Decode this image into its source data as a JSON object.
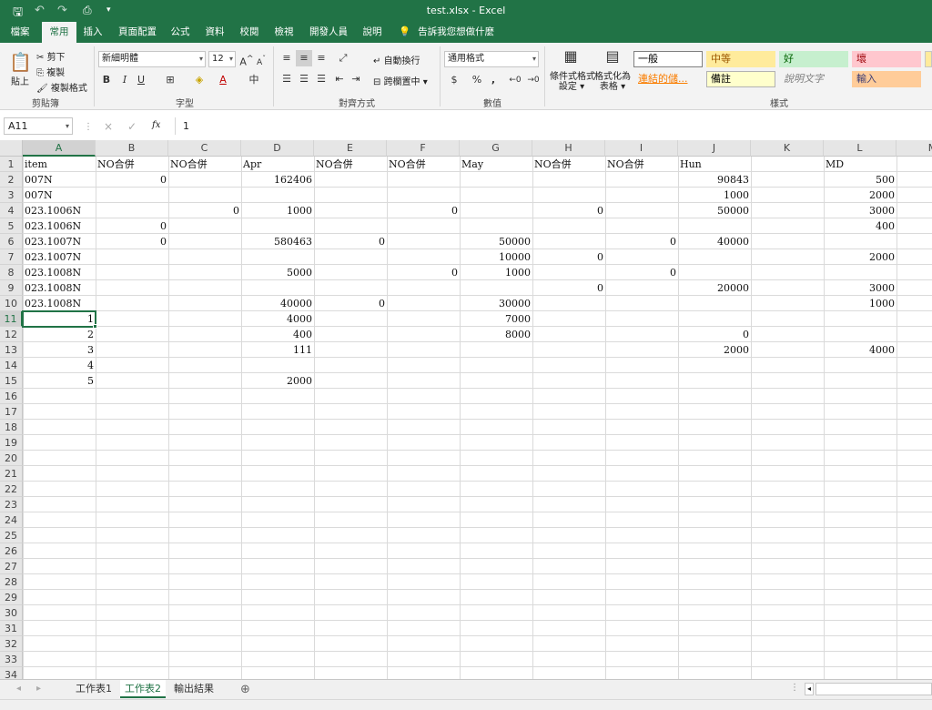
{
  "window": {
    "title": "test.xlsx  -  Excel",
    "quick_access": {
      "save_icon": "save-icon",
      "undo_icon": "undo-icon",
      "redo_icon": "redo-icon",
      "touch_icon": "touch-mode-icon",
      "customize": "▾"
    }
  },
  "ribbon_tabs": [
    "檔案",
    "常用",
    "插入",
    "頁面配置",
    "公式",
    "資料",
    "校閱",
    "檢視",
    "開發人員",
    "說明"
  ],
  "active_tab": "常用",
  "tell_me": "告訴我您想做什麼",
  "ribbon": {
    "clipboard": {
      "paste": "貼上",
      "cut": "剪下",
      "copy": "複製",
      "format_painter": "複製格式",
      "label": "剪貼簿"
    },
    "font": {
      "name": "新細明體",
      "size": "12",
      "bold": "B",
      "italic": "I",
      "underline": "U",
      "grow": "A",
      "shrink": "A",
      "label": "字型"
    },
    "alignment": {
      "wrap_text": "自動換行",
      "merge_center": "跨欄置中",
      "label": "對齊方式"
    },
    "number": {
      "format": "通用格式",
      "currency": "$",
      "percent": "%",
      "comma": ",",
      "label": "數值"
    },
    "styles": {
      "conditional": [
        "條件式格式",
        "設定"
      ],
      "format_as_table": [
        "格式化為",
        "表格"
      ],
      "cells": [
        {
          "text": "一般",
          "bg": "#ffffff",
          "fg": "#000000",
          "border": "#7f7f7f"
        },
        {
          "text": "中等",
          "bg": "#ffeb9c",
          "fg": "#9c5700"
        },
        {
          "text": "好",
          "bg": "#c6efce",
          "fg": "#006100"
        },
        {
          "text": "壞",
          "bg": "#ffc7ce",
          "fg": "#9c0006"
        },
        {
          "text": "連結的儲...",
          "bg": "#f3f3f3",
          "fg": "#fa7d00"
        },
        {
          "text": "備註",
          "bg": "#ffffcc",
          "fg": "#000000",
          "border": "#b2b2b2"
        },
        {
          "text": "說明文字",
          "bg": "#f3f3f3",
          "fg": "#7f7f7f"
        },
        {
          "text": "輸入",
          "bg": "#ffcc99",
          "fg": "#3f3f76"
        }
      ],
      "label": "樣式"
    }
  },
  "formula_bar": {
    "name_box": "A11",
    "cancel": "×",
    "enter": "✓",
    "fx": "fx",
    "value": "1"
  },
  "grid": {
    "columns": [
      "A",
      "B",
      "C",
      "D",
      "E",
      "F",
      "G",
      "H",
      "I",
      "J",
      "K",
      "L",
      "M"
    ],
    "selected_column": "A",
    "selected_row": 11,
    "row_count": 35,
    "cells": [
      {
        "r": 1,
        "c": 0,
        "v": "item",
        "a": "l"
      },
      {
        "r": 1,
        "c": 1,
        "v": "NO合併",
        "a": "l"
      },
      {
        "r": 1,
        "c": 2,
        "v": "NO合併",
        "a": "l"
      },
      {
        "r": 1,
        "c": 3,
        "v": "Apr",
        "a": "l"
      },
      {
        "r": 1,
        "c": 4,
        "v": "NO合併",
        "a": "l"
      },
      {
        "r": 1,
        "c": 5,
        "v": "NO合併",
        "a": "l"
      },
      {
        "r": 1,
        "c": 6,
        "v": "May",
        "a": "l"
      },
      {
        "r": 1,
        "c": 7,
        "v": "NO合併",
        "a": "l"
      },
      {
        "r": 1,
        "c": 8,
        "v": "NO合併",
        "a": "l"
      },
      {
        "r": 1,
        "c": 9,
        "v": "Hun",
        "a": "l"
      },
      {
        "r": 1,
        "c": 11,
        "v": "MD",
        "a": "l"
      },
      {
        "r": 2,
        "c": 0,
        "v": "007N",
        "a": "l"
      },
      {
        "r": 2,
        "c": 1,
        "v": "0",
        "a": "r"
      },
      {
        "r": 2,
        "c": 3,
        "v": "162406",
        "a": "r"
      },
      {
        "r": 2,
        "c": 9,
        "v": "90843",
        "a": "r"
      },
      {
        "r": 2,
        "c": 11,
        "v": "500",
        "a": "r"
      },
      {
        "r": 3,
        "c": 0,
        "v": "007N",
        "a": "l"
      },
      {
        "r": 3,
        "c": 9,
        "v": "1000",
        "a": "r"
      },
      {
        "r": 3,
        "c": 11,
        "v": "2000",
        "a": "r"
      },
      {
        "r": 4,
        "c": 0,
        "v": "023.1006N",
        "a": "l"
      },
      {
        "r": 4,
        "c": 2,
        "v": "0",
        "a": "r"
      },
      {
        "r": 4,
        "c": 3,
        "v": "1000",
        "a": "r"
      },
      {
        "r": 4,
        "c": 5,
        "v": "0",
        "a": "r"
      },
      {
        "r": 4,
        "c": 7,
        "v": "0",
        "a": "r"
      },
      {
        "r": 4,
        "c": 9,
        "v": "50000",
        "a": "r"
      },
      {
        "r": 4,
        "c": 11,
        "v": "3000",
        "a": "r"
      },
      {
        "r": 5,
        "c": 0,
        "v": "023.1006N",
        "a": "l"
      },
      {
        "r": 5,
        "c": 1,
        "v": "0",
        "a": "r"
      },
      {
        "r": 5,
        "c": 11,
        "v": "400",
        "a": "r"
      },
      {
        "r": 6,
        "c": 0,
        "v": "023.1007N",
        "a": "l"
      },
      {
        "r": 6,
        "c": 1,
        "v": "0",
        "a": "r"
      },
      {
        "r": 6,
        "c": 3,
        "v": "580463",
        "a": "r"
      },
      {
        "r": 6,
        "c": 4,
        "v": "0",
        "a": "r"
      },
      {
        "r": 6,
        "c": 6,
        "v": "50000",
        "a": "r"
      },
      {
        "r": 6,
        "c": 8,
        "v": "0",
        "a": "r"
      },
      {
        "r": 6,
        "c": 9,
        "v": "40000",
        "a": "r"
      },
      {
        "r": 7,
        "c": 0,
        "v": "023.1007N",
        "a": "l"
      },
      {
        "r": 7,
        "c": 6,
        "v": "10000",
        "a": "r"
      },
      {
        "r": 7,
        "c": 7,
        "v": "0",
        "a": "r"
      },
      {
        "r": 7,
        "c": 11,
        "v": "2000",
        "a": "r"
      },
      {
        "r": 8,
        "c": 0,
        "v": "023.1008N",
        "a": "l"
      },
      {
        "r": 8,
        "c": 3,
        "v": "5000",
        "a": "r"
      },
      {
        "r": 8,
        "c": 5,
        "v": "0",
        "a": "r"
      },
      {
        "r": 8,
        "c": 6,
        "v": "1000",
        "a": "r"
      },
      {
        "r": 8,
        "c": 8,
        "v": "0",
        "a": "r"
      },
      {
        "r": 9,
        "c": 0,
        "v": "023.1008N",
        "a": "l"
      },
      {
        "r": 9,
        "c": 7,
        "v": "0",
        "a": "r"
      },
      {
        "r": 9,
        "c": 9,
        "v": "20000",
        "a": "r"
      },
      {
        "r": 9,
        "c": 11,
        "v": "3000",
        "a": "r"
      },
      {
        "r": 10,
        "c": 0,
        "v": "023.1008N",
        "a": "l"
      },
      {
        "r": 10,
        "c": 3,
        "v": "40000",
        "a": "r"
      },
      {
        "r": 10,
        "c": 4,
        "v": "0",
        "a": "r"
      },
      {
        "r": 10,
        "c": 6,
        "v": "30000",
        "a": "r"
      },
      {
        "r": 10,
        "c": 11,
        "v": "1000",
        "a": "r"
      },
      {
        "r": 11,
        "c": 0,
        "v": "1",
        "a": "r"
      },
      {
        "r": 11,
        "c": 3,
        "v": "4000",
        "a": "r"
      },
      {
        "r": 11,
        "c": 6,
        "v": "7000",
        "a": "r"
      },
      {
        "r": 12,
        "c": 0,
        "v": "2",
        "a": "r"
      },
      {
        "r": 12,
        "c": 3,
        "v": "400",
        "a": "r"
      },
      {
        "r": 12,
        "c": 6,
        "v": "8000",
        "a": "r"
      },
      {
        "r": 12,
        "c": 9,
        "v": "0",
        "a": "r"
      },
      {
        "r": 13,
        "c": 0,
        "v": "3",
        "a": "r"
      },
      {
        "r": 13,
        "c": 3,
        "v": "111",
        "a": "r"
      },
      {
        "r": 13,
        "c": 9,
        "v": "2000",
        "a": "r"
      },
      {
        "r": 13,
        "c": 11,
        "v": "4000",
        "a": "r"
      },
      {
        "r": 14,
        "c": 0,
        "v": "4",
        "a": "r"
      },
      {
        "r": 15,
        "c": 0,
        "v": "5",
        "a": "r"
      },
      {
        "r": 15,
        "c": 3,
        "v": "2000",
        "a": "r"
      }
    ]
  },
  "sheets": [
    "工作表1",
    "工作表2",
    "輸出結果"
  ],
  "active_sheet": "工作表2",
  "add_sheet": "⊕"
}
